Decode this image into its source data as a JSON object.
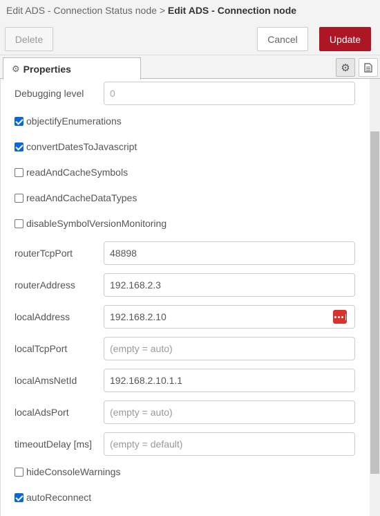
{
  "breadcrumb": {
    "parent": "Edit ADS - Connection Status node",
    "separator": ">",
    "current": "Edit ADS - Connection node"
  },
  "toolbar": {
    "delete_label": "Delete",
    "cancel_label": "Cancel",
    "update_label": "Update",
    "accent_color": "#ad1625"
  },
  "tabs": {
    "properties_label": "Properties"
  },
  "fields": {
    "debugging_level": {
      "label": "Debugging level",
      "value": "0"
    },
    "router_tcp_port": {
      "label": "routerTcpPort",
      "value": "48898"
    },
    "router_address": {
      "label": "routerAddress",
      "value": "192.168.2.3"
    },
    "local_address": {
      "label": "localAddress",
      "value": "192.168.2.10"
    },
    "local_tcp_port": {
      "label": "localTcpPort",
      "placeholder": "(empty = auto)"
    },
    "local_ams_net_id": {
      "label": "localAmsNetId",
      "value": "192.168.2.10.1.1"
    },
    "local_ads_port": {
      "label": "localAdsPort",
      "placeholder": "(empty = auto)"
    },
    "timeout_delay": {
      "label": "timeoutDelay [ms]",
      "placeholder": "(empty = default)"
    }
  },
  "checkboxes": {
    "objectify_enumerations": {
      "label": "objectifyEnumerations",
      "checked": true
    },
    "convert_dates": {
      "label": "convertDatesToJavascript",
      "checked": true
    },
    "read_cache_symbols": {
      "label": "readAndCacheSymbols",
      "checked": false
    },
    "read_cache_datatypes": {
      "label": "readAndCacheDataTypes",
      "checked": false
    },
    "disable_symbol_version": {
      "label": "disableSymbolVersionMonitoring",
      "checked": false
    },
    "hide_console_warnings": {
      "label": "hideConsoleWarnings",
      "checked": false
    },
    "auto_reconnect": {
      "label": "autoReconnect",
      "checked": true
    }
  },
  "icons": {
    "tab_icon": "gear-icon",
    "settings_button": "gear-icon",
    "info_button": "document-icon",
    "address_picker": "dots-icon"
  }
}
